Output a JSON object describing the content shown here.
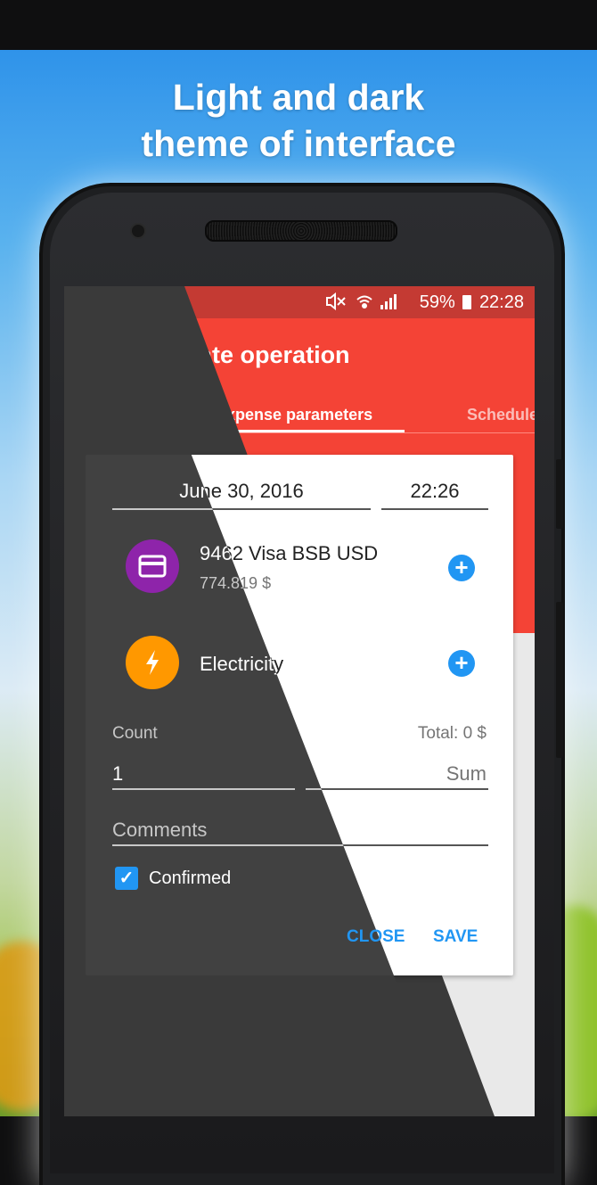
{
  "promo": {
    "headline_line1": "Light and dark",
    "headline_line2": "theme of interface"
  },
  "status_bar": {
    "icons": [
      "mute-icon",
      "wifi-icon",
      "signal-icon"
    ],
    "battery": "59%",
    "time": "22:28"
  },
  "app_bar": {
    "title": "Create operation",
    "back_icon": "back-arrow-icon"
  },
  "tabs": [
    {
      "label": "Expense parameters",
      "active": true
    },
    {
      "label": "Schedule",
      "active": false
    }
  ],
  "form": {
    "date": "June 30, 2016",
    "time": "22:26",
    "account": {
      "name": "9462 Visa BSB USD",
      "balance": "774.819 $",
      "icon": "credit-card-icon",
      "icon_color": "#8e24aa"
    },
    "category": {
      "name": "Electricity",
      "icon": "lightning-icon",
      "icon_color": "#ff9800"
    },
    "count_label": "Count",
    "total_label": "Total: 0 $",
    "count_value": "1",
    "sum_placeholder": "Sum",
    "comments_placeholder": "Comments",
    "confirmed_label": "Confirmed",
    "confirmed": true,
    "close_label": "CLOSE",
    "save_label": "SAVE"
  },
  "colors": {
    "accent": "#2196f3",
    "primary": "#f44336",
    "status_bar": "#c43a33",
    "dark_card": "#414141"
  }
}
